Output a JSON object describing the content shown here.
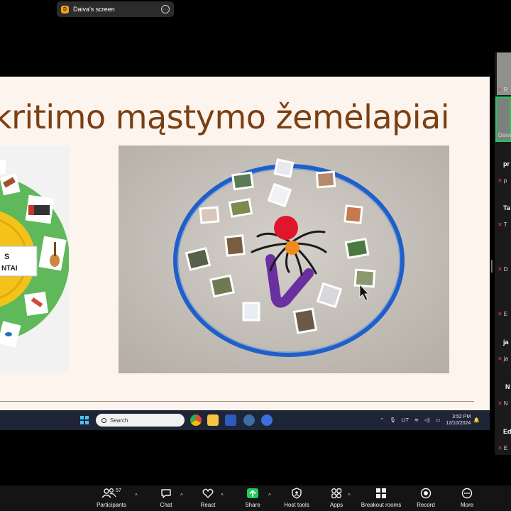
{
  "share_bar": {
    "presenter_label": "Daiva's screen",
    "badge": "D"
  },
  "slide": {
    "title": "kritimo mąstymo žemėlapiai",
    "left_card_text": [
      "S",
      "NTAI"
    ],
    "footer_text": "",
    "page_number": ""
  },
  "taskbar": {
    "search_placeholder": "Search",
    "language": "LIT",
    "time": "3:52 PM",
    "date": "12/10/2024"
  },
  "gallery": {
    "tiles": [
      {
        "text": "R"
      },
      {
        "text": "Daiva"
      },
      {
        "name": "pr",
        "sub": "p"
      },
      {
        "name": "Ta",
        "sub": "T"
      },
      {
        "sub": "D"
      },
      {
        "sub": "E"
      },
      {
        "name": "ja",
        "sub": "ja"
      },
      {
        "name": "N",
        "sub": "N"
      },
      {
        "name": "Ed",
        "sub": "E"
      }
    ]
  },
  "toolbar": {
    "participants_count": "57",
    "buttons": [
      {
        "label": "Participants",
        "icon": "participants-icon"
      },
      {
        "label": "Chat",
        "icon": "chat-icon"
      },
      {
        "label": "React",
        "icon": "heart-icon"
      },
      {
        "label": "Share",
        "icon": "share-icon"
      },
      {
        "label": "Host tools",
        "icon": "shield-icon"
      },
      {
        "label": "Apps",
        "icon": "apps-icon"
      },
      {
        "label": "Breakout rooms",
        "icon": "breakout-icon"
      },
      {
        "label": "Record",
        "icon": "record-icon"
      },
      {
        "label": "More",
        "icon": "more-icon"
      }
    ]
  },
  "colors": {
    "title": "#7b3f12",
    "share_green": "#1ecb5c",
    "muted_red": "#e2453a",
    "hoop_blue": "#1f5fc9"
  }
}
